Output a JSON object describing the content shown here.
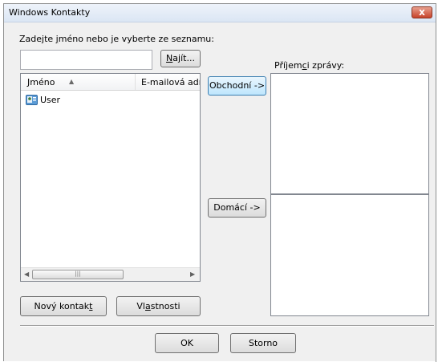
{
  "window": {
    "title": "Windows Kontakty",
    "close_label": "x"
  },
  "search": {
    "label_before": "Zadejte ",
    "label_accel": "j",
    "label_after": "méno nebo je vyberte ze seznamu:",
    "value": "",
    "find_accel": "N",
    "find_rest": "ajít..."
  },
  "list": {
    "columns": [
      {
        "label": "Jméno",
        "sort_icon": "sort-ascending-icon"
      },
      {
        "label": "E-mailová adr"
      }
    ],
    "rows": [
      {
        "name": "User",
        "icon": "contact-card-icon"
      }
    ]
  },
  "recipients": {
    "label_before": "Příjem",
    "label_accel": "c",
    "label_after": "i zprávy:",
    "business_button": "Obchodní ->",
    "home_button": "Domácí ->"
  },
  "bottom_buttons": {
    "new_contact_before": "Nový kontak",
    "new_contact_accel": "t",
    "properties_before": "Vl",
    "properties_accel": "a",
    "properties_after": "stnosti"
  },
  "footer": {
    "ok": "OK",
    "cancel": "Storno"
  },
  "colors": {
    "close_button": "#c7432a",
    "focus_border": "#3c7fb1"
  }
}
